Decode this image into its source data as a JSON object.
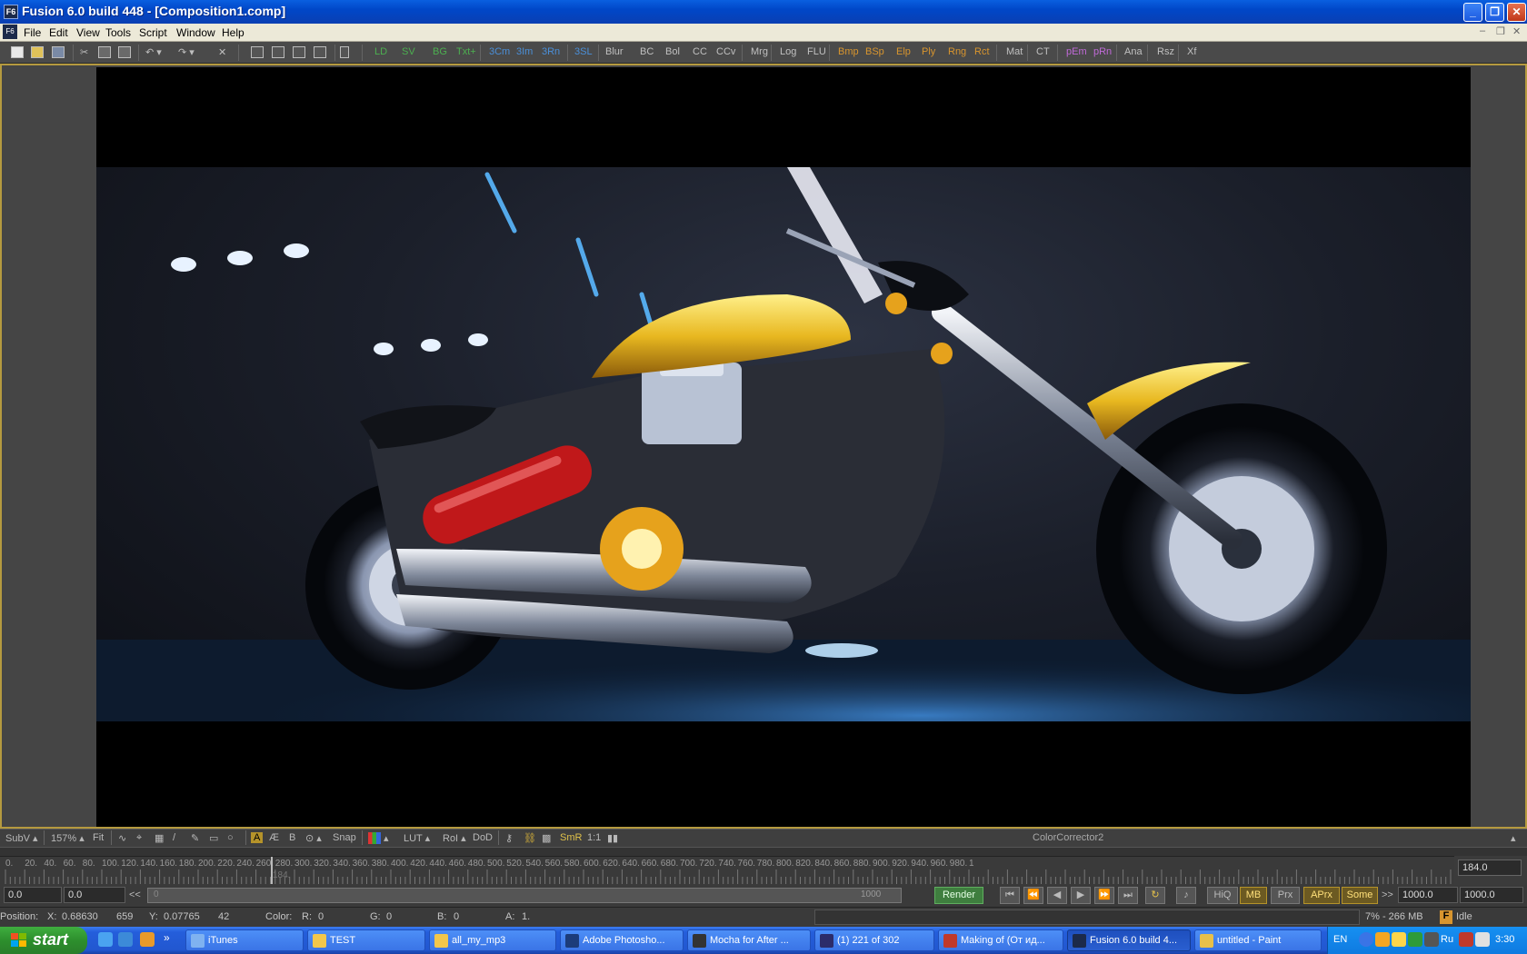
{
  "window": {
    "title": "Fusion 6.0 build 448 - [Composition1.comp]",
    "app_icon_text": "F6"
  },
  "menu": [
    "File",
    "Edit",
    "View",
    "Tools",
    "Script",
    "Window",
    "Help"
  ],
  "toolbar": {
    "tool_buttons": [
      {
        "label": "LD",
        "color": "#4caf50"
      },
      {
        "label": "SV",
        "color": "#4caf50"
      },
      {
        "label": "BG",
        "color": "#4caf50"
      },
      {
        "label": "Txt+",
        "color": "#4caf50"
      },
      {
        "label": "3Cm",
        "color": "#4a8fd8"
      },
      {
        "label": "3Im",
        "color": "#4a8fd8"
      },
      {
        "label": "3Rn",
        "color": "#4a8fd8"
      },
      {
        "label": "3SL",
        "color": "#4a8fd8"
      },
      {
        "label": "Blur",
        "color": "#c0c0c0"
      },
      {
        "label": "BC",
        "color": "#c0c0c0"
      },
      {
        "label": "Bol",
        "color": "#c0c0c0"
      },
      {
        "label": "CC",
        "color": "#c0c0c0"
      },
      {
        "label": "CCv",
        "color": "#c0c0c0"
      },
      {
        "label": "Mrg",
        "color": "#c0c0c0"
      },
      {
        "label": "Log",
        "color": "#c0c0c0"
      },
      {
        "label": "FLU",
        "color": "#c0c0c0"
      },
      {
        "label": "Bmp",
        "color": "#d8952e"
      },
      {
        "label": "BSp",
        "color": "#d8952e"
      },
      {
        "label": "Elp",
        "color": "#d8952e"
      },
      {
        "label": "Ply",
        "color": "#d8952e"
      },
      {
        "label": "Rng",
        "color": "#d8952e"
      },
      {
        "label": "Rct",
        "color": "#d8952e"
      },
      {
        "label": "Mat",
        "color": "#c0c0c0"
      },
      {
        "label": "CT",
        "color": "#c0c0c0"
      },
      {
        "label": "pEm",
        "color": "#c06ad8"
      },
      {
        "label": "pRn",
        "color": "#c06ad8"
      },
      {
        "label": "Ana",
        "color": "#c0c0c0"
      },
      {
        "label": "Rsz",
        "color": "#c0c0c0"
      },
      {
        "label": "Xf",
        "color": "#c0c0c0"
      }
    ]
  },
  "viewer": {
    "subv": "SubV",
    "zoom": "157%",
    "fit": "Fit",
    "b_label": "B",
    "snap": "Snap",
    "lut": "LUT",
    "roi": "RoI",
    "dod": "DoD",
    "smr": "SmR",
    "ratio": "1:1",
    "tool_name": "ColorCorrector2"
  },
  "timeline": {
    "ticks": [
      "0.",
      "20.",
      "40.",
      "60.",
      "80.",
      "100.",
      "120.",
      "140.",
      "160.",
      "180.",
      "200.",
      "220.",
      "240.",
      "260.",
      "280.",
      "300.",
      "320.",
      "340.",
      "360.",
      "380.",
      "400.",
      "420.",
      "440.",
      "460.",
      "480.",
      "500.",
      "520.",
      "540.",
      "560.",
      "580.",
      "600.",
      "620.",
      "640.",
      "660.",
      "680.",
      "700.",
      "720.",
      "740.",
      "760.",
      "780.",
      "800.",
      "820.",
      "840.",
      "860.",
      "880.",
      "900.",
      "920.",
      "940.",
      "960.",
      "980.",
      "1"
    ],
    "playhead_label": "184.",
    "current_frame": "184.0"
  },
  "transport": {
    "global_start": "0.0",
    "render_start": "0.0",
    "range_nav": "<<",
    "slider_start": "0",
    "slider_end": "1000",
    "render_button": "Render",
    "hiq": "HiQ",
    "mb": "MB",
    "prx": "Prx",
    "aprx": "APrx",
    "some": "Some",
    "range_nav_end": ">>",
    "render_end": "1000.0",
    "global_end": "1000.0"
  },
  "status": {
    "position_label": "Position:",
    "x_label": "X:",
    "x_value": "0.68630",
    "x_px": "659",
    "y_label": "Y:",
    "y_value": "0.07765",
    "y_px": "42",
    "color_label": "Color:",
    "r_label": "R:",
    "r_value": "0",
    "g_label": "G:",
    "g_value": "0",
    "b_label": "B:",
    "b_value": "0",
    "a_label": "A:",
    "a_value": "1.",
    "memory": "7% - 266 MB",
    "state_icon": "F",
    "state": "Idle"
  },
  "taskbar": {
    "start": "start",
    "tasks": [
      {
        "label": "iTunes",
        "icon_color": "#7fb2f0"
      },
      {
        "label": "TEST",
        "icon_color": "#f3c74b"
      },
      {
        "label": "all_my_mp3",
        "icon_color": "#f3c74b"
      },
      {
        "label": "Adobe Photosho...",
        "icon_color": "#1c3c7a"
      },
      {
        "label": "Mocha for After ...",
        "icon_color": "#333333"
      },
      {
        "label": "(1) 221 of 302",
        "icon_color": "#2c2c6a"
      },
      {
        "label": "Making of (От ид...",
        "icon_color": "#c0392b"
      },
      {
        "label": "Fusion 6.0 build 4...",
        "icon_color": "#1c2a4a"
      },
      {
        "label": "untitled - Paint",
        "icon_color": "#e8c04a"
      }
    ],
    "lang": "EN",
    "lang2": "Ru",
    "clock": "3:30"
  },
  "accent": {
    "viewer_border": "#b59a3f",
    "xp_blue": "#245edb",
    "start_green": "#2d8f2d"
  }
}
